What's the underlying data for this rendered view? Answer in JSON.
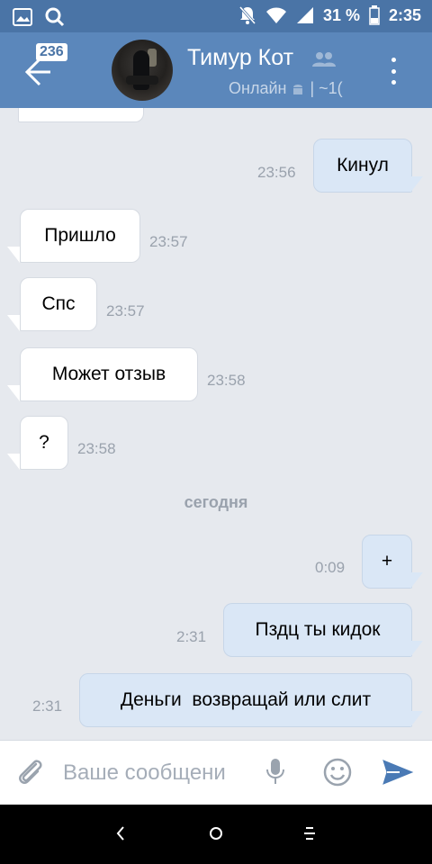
{
  "status_bar": {
    "battery": "31 %",
    "time": "2:35",
    "icons": [
      "gallery-icon",
      "search-icon",
      "muted-bell-icon",
      "wifi-icon",
      "signal-icon",
      "battery-icon"
    ]
  },
  "header": {
    "unread_badge": "236",
    "name": "Тимур Кот",
    "status": "Онлайн",
    "status_suffix": "| ~1("
  },
  "messages": [
    {
      "text": "Кинул",
      "time": "23:56",
      "dir": "out"
    },
    {
      "text": "Пришло",
      "time": "23:57",
      "dir": "in"
    },
    {
      "text": "Спс",
      "time": "23:57",
      "dir": "in"
    },
    {
      "text": "Может отзыв",
      "time": "23:58",
      "dir": "in"
    },
    {
      "text": "?",
      "time": "23:58",
      "dir": "in"
    },
    {
      "text": "+",
      "time": "0:09",
      "dir": "out"
    },
    {
      "text": "Пздц ты кидок",
      "time": "2:31",
      "dir": "out"
    },
    {
      "text": "Деньги  возвращай или слит",
      "time": "2:31",
      "dir": "out"
    }
  ],
  "date_separator": "сегодня",
  "input": {
    "placeholder": "Ваше сообщени"
  },
  "colors": {
    "header": "#5b87bb",
    "status_bar": "#4a74a6",
    "outgoing_bubble": "#dae7f6",
    "incoming_bubble": "#ffffff",
    "chat_bg": "#e6e9ee",
    "send_icon": "#4a7ab5"
  }
}
